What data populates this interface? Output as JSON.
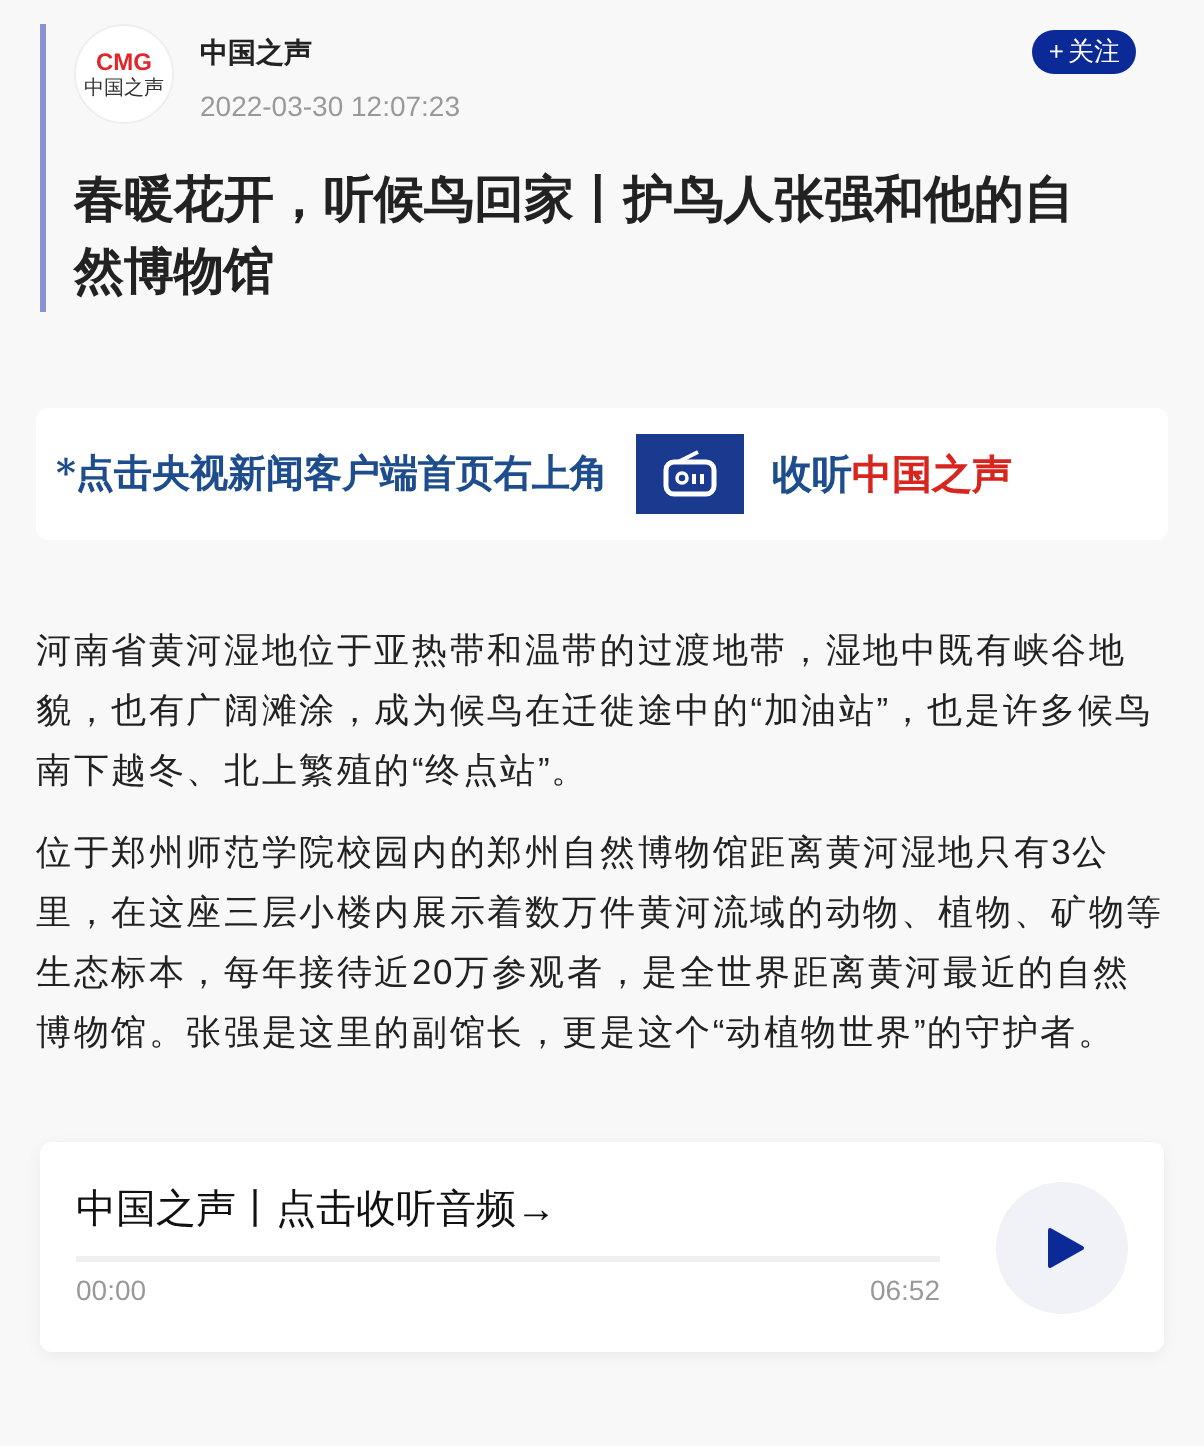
{
  "author": {
    "logo_mark": "CMG",
    "logo_name": "中国之声",
    "name": "中国之声",
    "time": "2022-03-30 12:07:23"
  },
  "follow_button": {
    "icon": "+",
    "label": "关注"
  },
  "title": "春暖花开，听候鸟回家丨护鸟人张强和他的自然博物馆",
  "banner": {
    "prompt": "*点击央视新闻客户端首页右上角",
    "action": "收听",
    "channel": "中国之声"
  },
  "paragraphs": [
    "河南省黄河湿地位于亚热带和温带的过渡地带，湿地中既有峡谷地貌，也有广阔滩涂，成为候鸟在迁徙途中的“加油站”，也是许多候鸟南下越冬、北上繁殖的“终点站”。",
    "位于郑州师范学院校园内的郑州自然博物馆距离黄河湿地只有3公里，在这座三层小楼内展示着数万件黄河流域的动物、植物、矿物等生态标本，每年接待近20万参观者，是全世界距离黄河最近的自然博物馆。张强是这里的副馆长，更是这个“动植物世界”的守护者。"
  ],
  "audio": {
    "title": "中国之声丨点击收听音频→",
    "level": 0,
    "current": "00:00",
    "duration": "06:52",
    "playing": false
  }
}
